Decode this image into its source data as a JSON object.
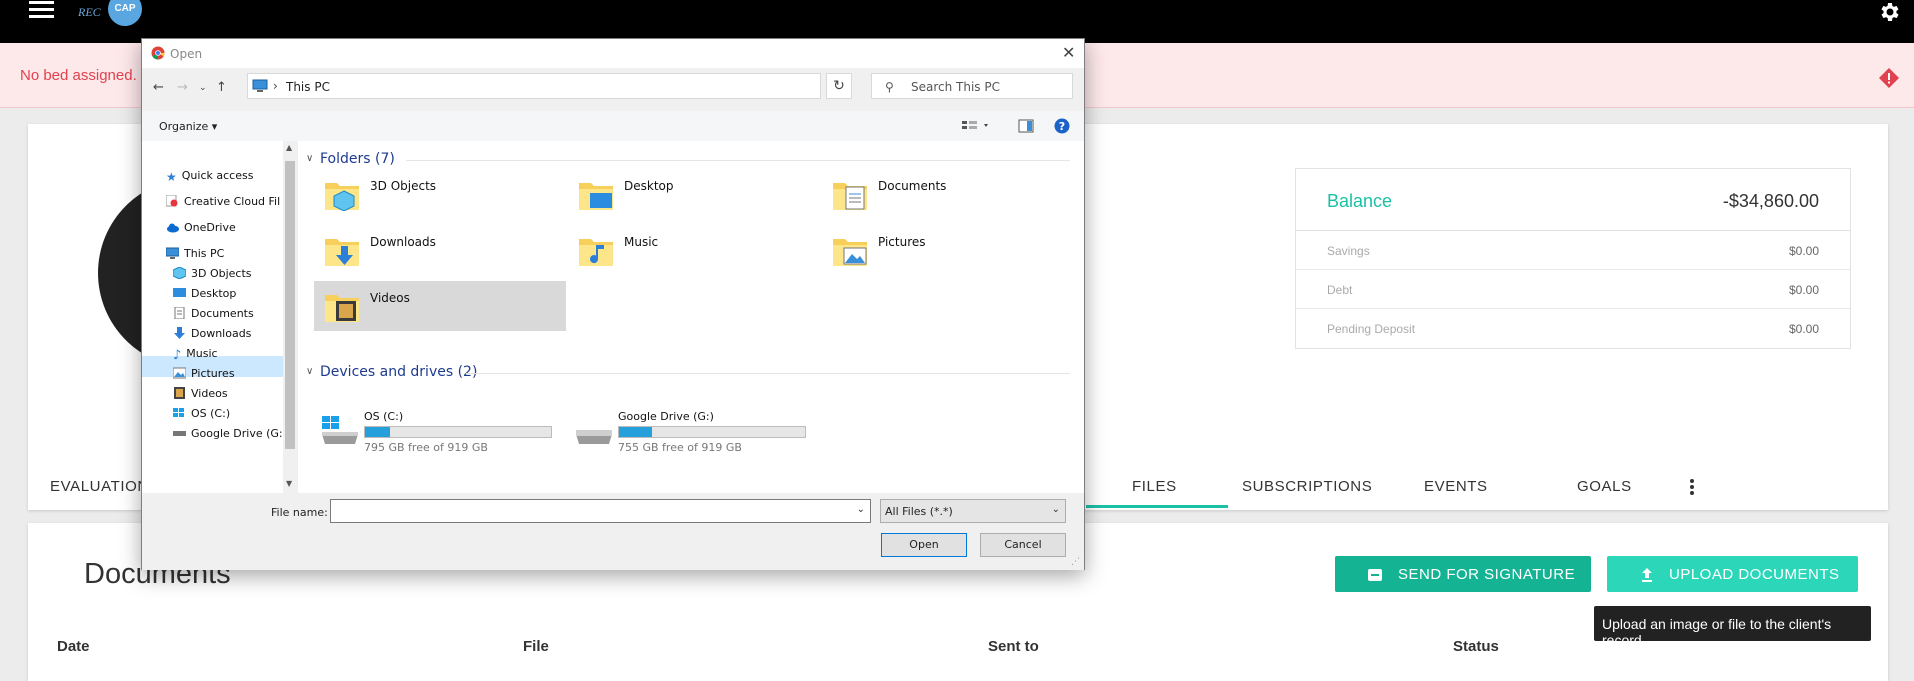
{
  "app": {
    "logo_text": "REC",
    "logo_badge": "CAP"
  },
  "alert": {
    "text": "No bed assigned."
  },
  "balance": {
    "label": "Balance",
    "value": "-$34,860.00",
    "rows": [
      {
        "label": "Savings",
        "value": "$0.00"
      },
      {
        "label": "Debt",
        "value": "$0.00"
      },
      {
        "label": "Pending Deposit",
        "value": "$0.00"
      }
    ]
  },
  "tabs": [
    "EVALUATION",
    "FILES",
    "SUBSCRIPTIONS",
    "EVENTS",
    "GOALS"
  ],
  "documents": {
    "title": "Documents",
    "send_label": "SEND FOR SIGNATURE",
    "upload_label": "UPLOAD DOCUMENTS",
    "tooltip": "Upload an image or file to the client's record",
    "columns": [
      "Date",
      "File",
      "Sent to",
      "Status"
    ]
  },
  "dialog": {
    "title": "Open",
    "address": "This PC",
    "search_placeholder": "Search This PC",
    "organize": "Organize",
    "nav_items": [
      "Quick access",
      "Creative Cloud Fil",
      "OneDrive",
      "This PC",
      "3D Objects",
      "Desktop",
      "Documents",
      "Downloads",
      "Music",
      "Pictures",
      "Videos",
      "OS (C:)",
      "Google Drive (G:"
    ],
    "folders_header": "Folders (7)",
    "folders": [
      "3D Objects",
      "Desktop",
      "Documents",
      "Downloads",
      "Music",
      "Pictures",
      "Videos"
    ],
    "drives_header": "Devices and drives (2)",
    "drives": [
      {
        "name": "OS (C:)",
        "free": "795 GB free of 919 GB",
        "used_fraction": 0.135
      },
      {
        "name": "Google Drive (G:)",
        "free": "755 GB free of 919 GB",
        "used_fraction": 0.178
      }
    ],
    "file_name_label": "File name:",
    "file_name_value": "",
    "filter": "All Files (*.*)",
    "open_label": "Open",
    "cancel_label": "Cancel"
  },
  "colors": {
    "accent": "#1bc1a5",
    "alert_text": "#e0434f",
    "selection": "#cce8ff"
  }
}
